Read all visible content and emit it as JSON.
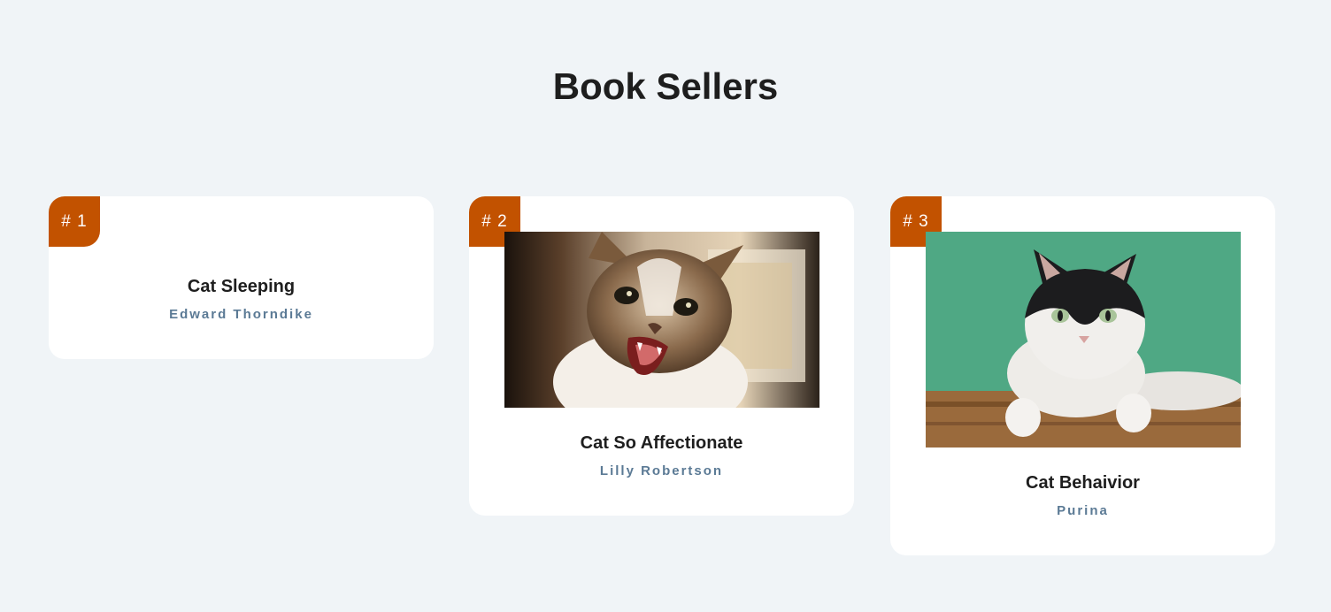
{
  "page": {
    "title": "Book Sellers"
  },
  "books": [
    {
      "rank": "# 1",
      "title": "Cat Sleeping",
      "author": "Edward Thorndike"
    },
    {
      "rank": "# 2",
      "title": "Cat So Affectionate",
      "author": "Lilly Robertson"
    },
    {
      "rank": "# 3",
      "title": "Cat Behaivior",
      "author": "Purina"
    }
  ],
  "colors": {
    "background": "#f0f4f7",
    "badge": "#c25200",
    "author": "#5b7a95",
    "title": "#1e1e1e"
  }
}
